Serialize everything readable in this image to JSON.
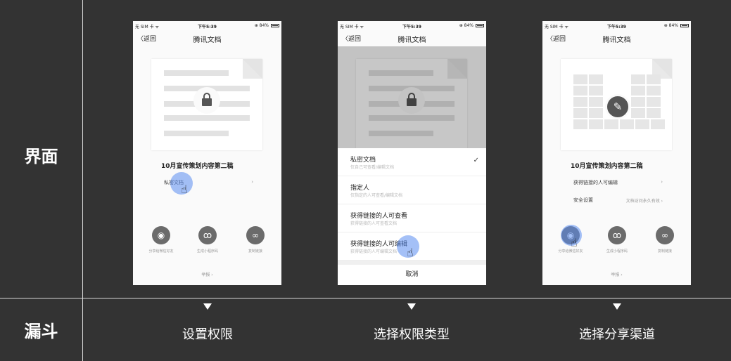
{
  "row_labels": {
    "interface": "界面",
    "funnel": "漏斗"
  },
  "status_bar": {
    "carrier": "无 SIM 卡 ᯤ",
    "time": "下午5:39",
    "battery": "⊕ 84%"
  },
  "nav": {
    "back": "〈返回",
    "title": "腾讯文档"
  },
  "screen1": {
    "doc_name": "10月宣传策划内容第二稿",
    "permission_label": "私密文档",
    "chevron": "›",
    "share": [
      {
        "label": "分享给微信好友",
        "icon": "wechat-icon"
      },
      {
        "label": "生成小程序码",
        "icon": "miniprogram-icon"
      },
      {
        "label": "复制链接",
        "icon": "link-icon"
      }
    ],
    "report": "举报 ›"
  },
  "screen2": {
    "options": [
      {
        "title": "私密文档",
        "subtitle": "仅自己可查看/编辑文档",
        "checked": true
      },
      {
        "title": "指定人",
        "subtitle": "仅指定的人可查看/编辑文档",
        "checked": false
      },
      {
        "title": "获得链接的人可查看",
        "subtitle": "获得链接的人可查看文档",
        "checked": false
      },
      {
        "title": "获得链接的人可编辑",
        "subtitle": "获得链接的人可编辑文档",
        "checked": false
      }
    ],
    "check_mark": "✓",
    "cancel": "取消"
  },
  "screen3": {
    "doc_name": "10月宣传策划内容第二稿",
    "permission_label": "获得链接的人可编辑",
    "security_label": "安全设置",
    "security_value": "文档访问永久有效 ›",
    "chevron": "›",
    "share": [
      {
        "label": "分享给微信好友",
        "icon": "wechat-icon"
      },
      {
        "label": "生成小程序码",
        "icon": "miniprogram-icon"
      },
      {
        "label": "复制链接",
        "icon": "link-icon"
      }
    ],
    "report": "举报 ›"
  },
  "funnel_steps": [
    "设置权限",
    "选择权限类型",
    "选择分享渠道"
  ],
  "colors": {
    "background": "#333333",
    "highlight": "#5a8cf0",
    "divider": "#d9d9d9"
  }
}
